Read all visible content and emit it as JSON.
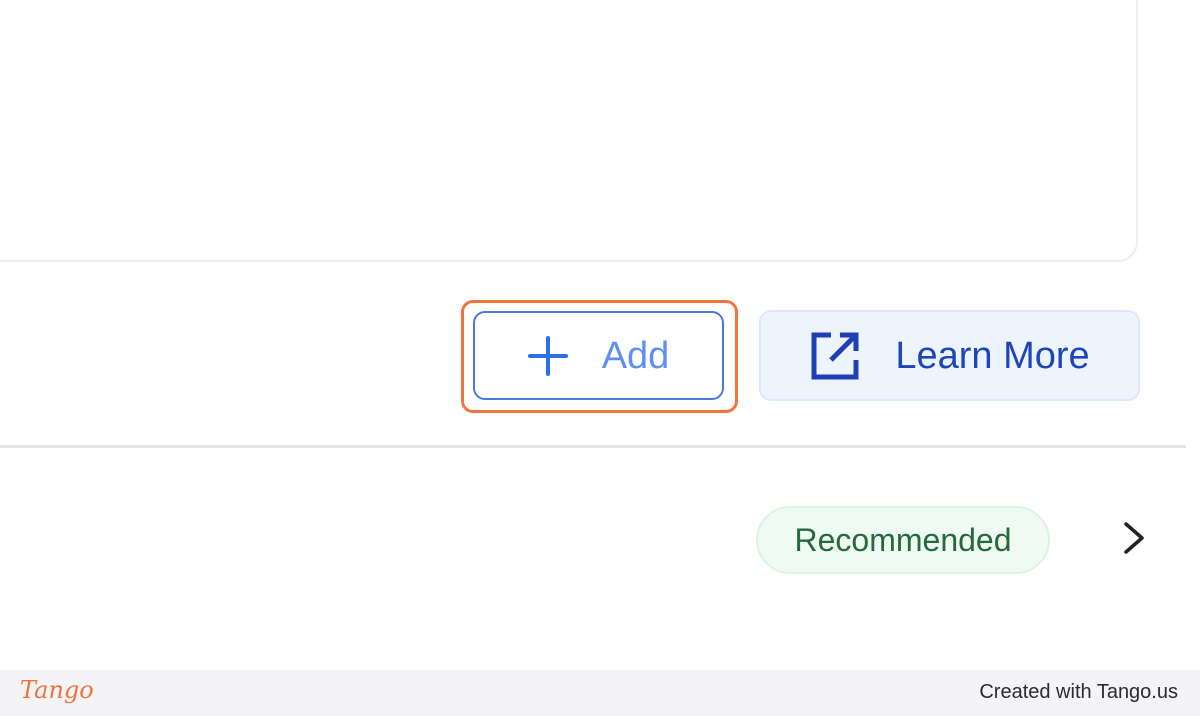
{
  "actions": {
    "add_label": "Add",
    "learn_more_label": "Learn More"
  },
  "item": {
    "badge": "Recommended"
  },
  "footer": {
    "logo": "Tango",
    "credit": "Created with Tango.us"
  },
  "icons": {
    "add": "plus-icon",
    "learn_more": "external-link-icon",
    "expand": "chevron-right-icon"
  },
  "colors": {
    "highlight": "#f0753d",
    "add_border": "#4a78dd",
    "add_text": "#5f8ff0",
    "learn_bg": "#eef4fe",
    "learn_text": "#1f46b8",
    "badge_bg": "#eefaf2",
    "badge_text": "#27693f"
  }
}
